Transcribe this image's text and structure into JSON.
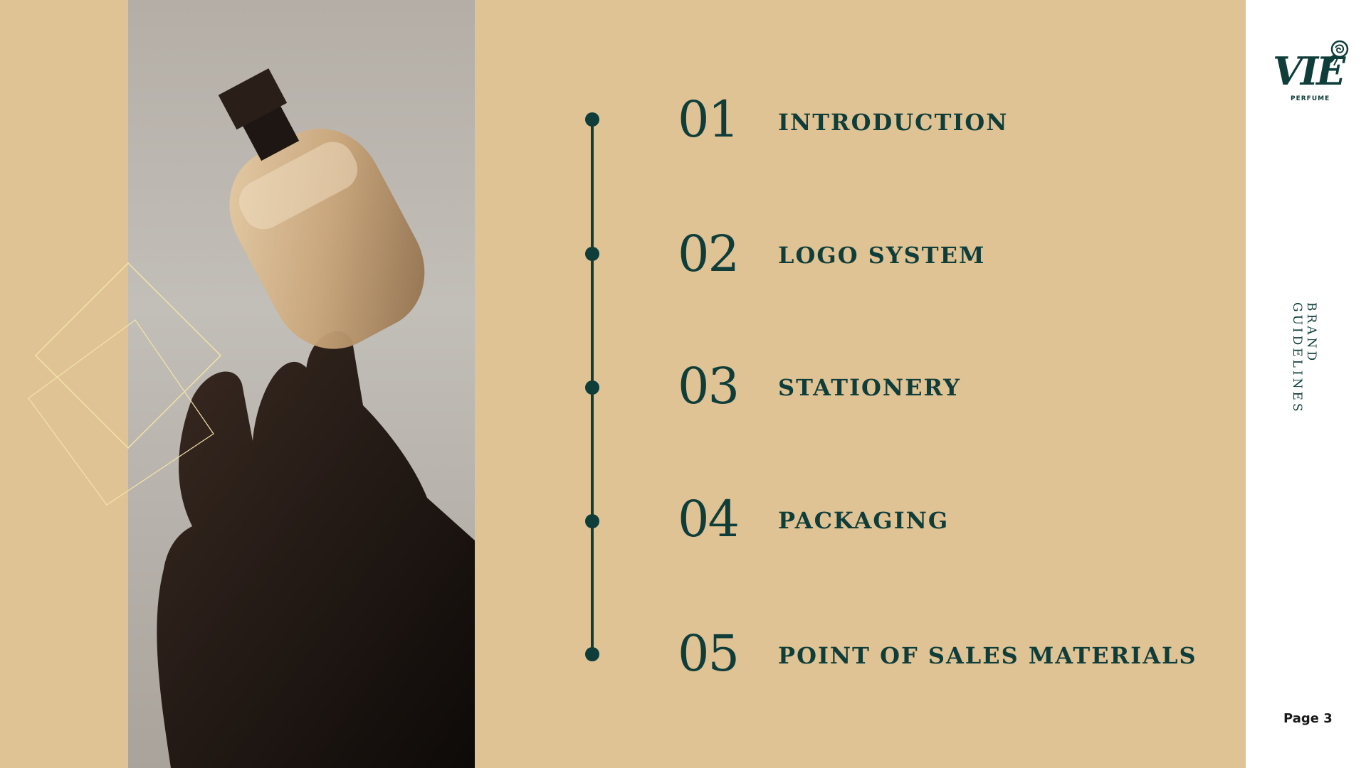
{
  "toc": {
    "items": [
      {
        "number": "01",
        "label": "INTRODUCTION"
      },
      {
        "number": "02",
        "label": "LOGO SYSTEM"
      },
      {
        "number": "03",
        "label": "STATIONERY"
      },
      {
        "number": "04",
        "label": "PACKAGING"
      },
      {
        "number": "05",
        "label": "POINT OF SALES MATERIALS"
      }
    ]
  },
  "brand": {
    "logo_text": "VIE",
    "logo_subtext": "PERFUME",
    "side_label": "BRAND GUIDELINES"
  },
  "footer": {
    "page_label": "Page 3"
  },
  "colors": {
    "background": "#dfc394",
    "accent": "#0f3d3a",
    "sidebar": "#ffffff"
  },
  "icons": {
    "logo_mark": "rose-icon",
    "photo": "perfume-bottle-image",
    "decoration": "diamond-outline-icon"
  }
}
